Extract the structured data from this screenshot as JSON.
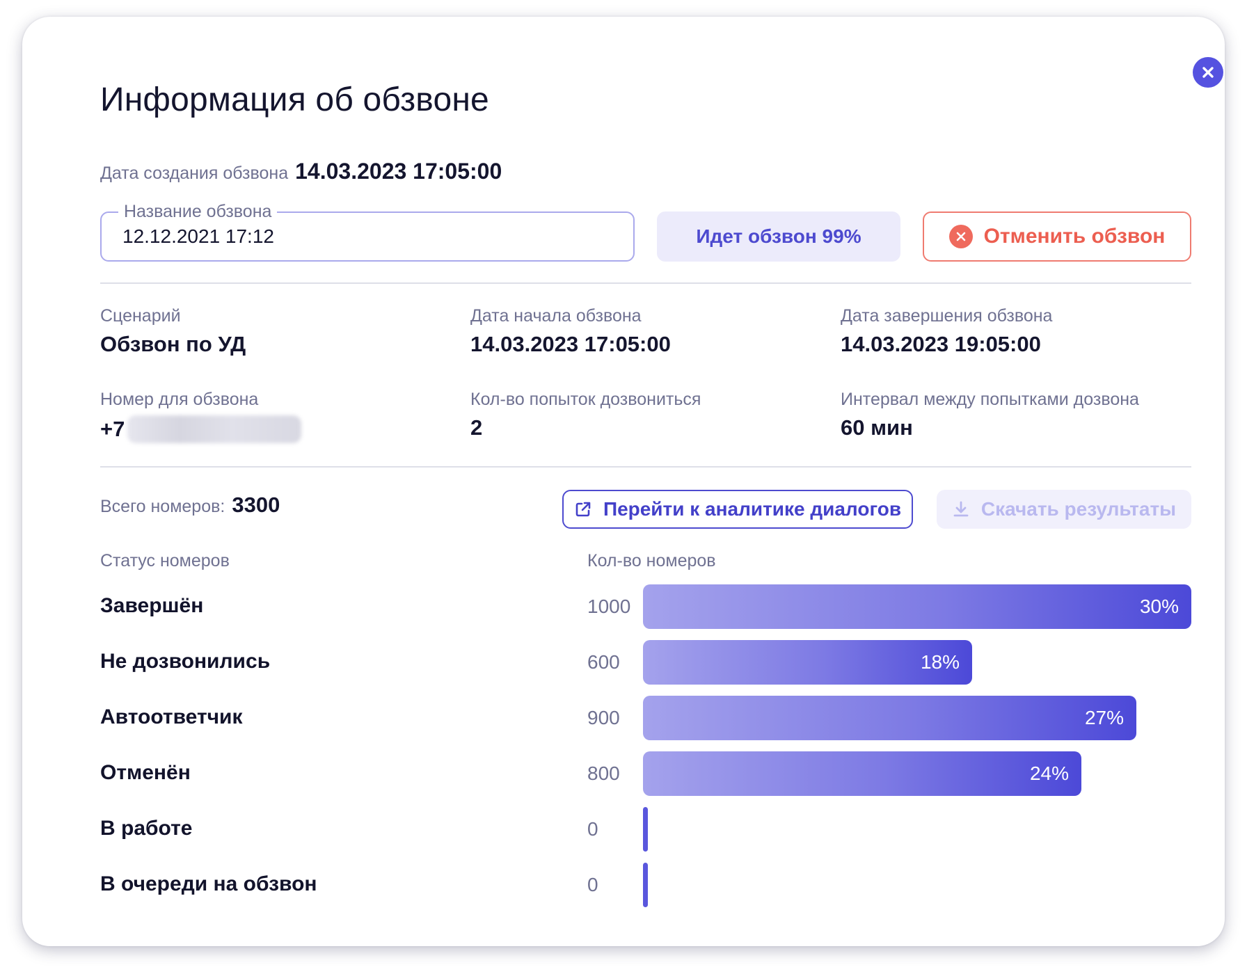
{
  "dialog": {
    "title": "Информация об обзвоне",
    "created_label": "Дата создания обзвона",
    "created_value": "14.03.2023 17:05:00",
    "name_field": {
      "label": "Название обзвона",
      "value": "12.12.2021 17:12"
    },
    "status_button": "Идет обзвон 99%",
    "cancel_button": "Отменить обзвон"
  },
  "info": {
    "scenario_label": "Сценарий",
    "scenario_value": "Обзвон по УД",
    "start_label": "Дата начала обзвона",
    "start_value": "14.03.2023 17:05:00",
    "end_label": "Дата завершения обзвона",
    "end_value": "14.03.2023 19:05:00",
    "phone_label": "Номер для обзвона",
    "phone_value": "+7",
    "attempts_label": "Кол-во попыток дозвониться",
    "attempts_value": "2",
    "interval_label": "Интервал между попытками дозвона",
    "interval_value": "60 мин"
  },
  "stats": {
    "total_label": "Всего номеров:",
    "total_value": "3300",
    "analytics_button": "Перейти к аналитике диалогов",
    "download_button": "Скачать результаты",
    "status_header": "Статус номеров",
    "count_header": "Кол-во номеров"
  },
  "chart_data": {
    "type": "bar",
    "orientation": "horizontal",
    "categories": [
      "Завершён",
      "Не дозвонились",
      "Автоответчик",
      "Отменён",
      "В работе",
      "В очереди на обзвон"
    ],
    "values": [
      1000,
      600,
      900,
      800,
      0,
      0
    ],
    "labels": [
      "30%",
      "18%",
      "27%",
      "24%",
      "",
      ""
    ],
    "max_value": 1000
  },
  "colors": {
    "accent": "#5552e0",
    "danger": "#ec5e50",
    "bar_start": "#a4a2ec",
    "bar_end": "#4c49d8"
  },
  "icons": {
    "close": "close-icon",
    "cancel": "cancel-circle-icon",
    "analytics": "external-link-icon",
    "download": "download-icon"
  }
}
